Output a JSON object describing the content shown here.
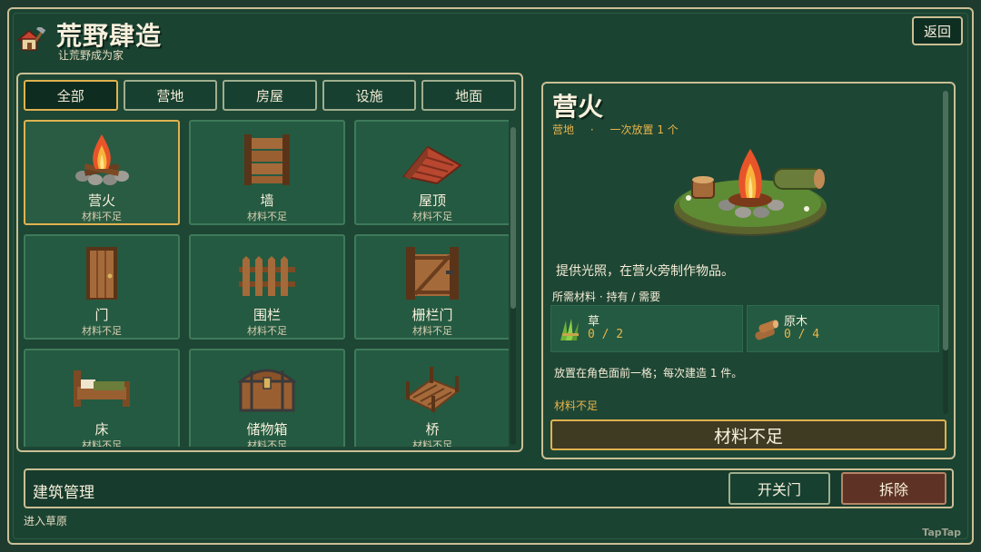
{
  "header": {
    "title": "荒野肆造",
    "subtitle": "让荒野成为家",
    "back_label": "返回"
  },
  "tabs": [
    {
      "label": "全部",
      "active": true
    },
    {
      "label": "营地",
      "active": false
    },
    {
      "label": "房屋",
      "active": false
    },
    {
      "label": "设施",
      "active": false
    },
    {
      "label": "地面",
      "active": false
    }
  ],
  "items": [
    {
      "name": "营火",
      "status": "材料不足",
      "icon": "campfire-icon",
      "selected": true
    },
    {
      "name": "墙",
      "status": "材料不足",
      "icon": "wall-icon"
    },
    {
      "name": "屋顶",
      "status": "材料不足",
      "icon": "roof-icon"
    },
    {
      "name": "门",
      "status": "材料不足",
      "icon": "door-icon"
    },
    {
      "name": "围栏",
      "status": "材料不足",
      "icon": "fence-icon"
    },
    {
      "name": "栅栏门",
      "status": "材料不足",
      "icon": "fence-gate-icon"
    },
    {
      "name": "床",
      "status": "材料不足",
      "icon": "bed-icon"
    },
    {
      "name": "储物箱",
      "status": "材料不足",
      "icon": "chest-icon"
    },
    {
      "name": "桥",
      "status": "材料不足",
      "icon": "bridge-icon"
    }
  ],
  "detail": {
    "title": "营火",
    "category": "营地",
    "separator": "·",
    "placement": "一次放置 1 个",
    "description": "提供光照，在营火旁制作物品。",
    "requirements_header": "所需材料 · 持有 / 需要",
    "requirements": [
      {
        "name": "草",
        "count": "0 / 2",
        "icon": "grass-icon"
      },
      {
        "name": "原木",
        "count": "0 / 4",
        "icon": "log-icon"
      }
    ],
    "placement_note": "放置在角色面前一格；每次建造 1 件。",
    "warning": "材料不足",
    "button_label": "材料不足"
  },
  "bottom": {
    "manage_label": "建筑管理",
    "toggle_door_label": "开关门",
    "demolish_label": "拆除",
    "status": "进入草原"
  },
  "watermark": "TapTap"
}
